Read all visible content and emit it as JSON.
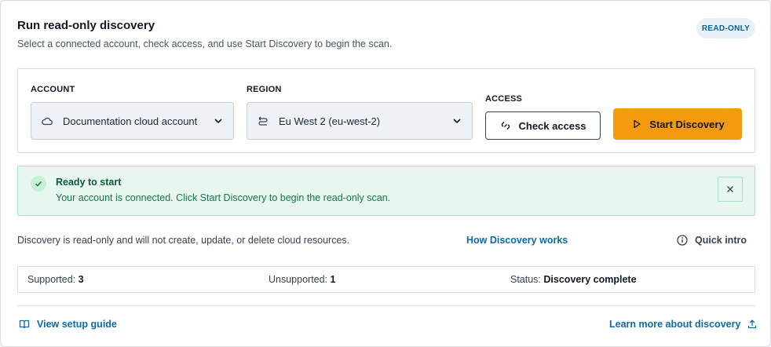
{
  "header": {
    "title": "Run read-only discovery",
    "subtitle": "Select a connected account, check access, and use Start Discovery to begin the scan.",
    "badge": "READ-ONLY"
  },
  "form": {
    "account": {
      "label": "ACCOUNT",
      "value": "Documentation cloud account",
      "icon": "cloud-icon"
    },
    "region": {
      "label": "REGION",
      "value": "Eu West 2 (eu-west-2)",
      "icon": "region-icon"
    },
    "access": {
      "label": "ACCESS",
      "check_label": "Check access",
      "start_label": "Start Discovery"
    }
  },
  "alert": {
    "title": "Ready to start",
    "message": "Your account is connected. Click Start Discovery to begin the read-only scan."
  },
  "info": {
    "text": "Discovery is read-only and will not create, update, or delete cloud resources.",
    "how_link": "How Discovery works",
    "quick_intro": "Quick intro"
  },
  "stats": {
    "supported_label": "Supported:",
    "supported_value": "3",
    "unsupported_label": "Unsupported:",
    "unsupported_value": "1",
    "status_label": "Status:",
    "status_value": "Discovery complete"
  },
  "footer": {
    "setup_guide": "View setup guide",
    "learn_more": "Learn more about discovery"
  },
  "colors": {
    "primary_button": "#f59a0c",
    "link": "#0b6aa8",
    "success_bg": "#e7f7ef",
    "success_text": "#0d5a36",
    "badge_bg": "#e6f1f8"
  }
}
